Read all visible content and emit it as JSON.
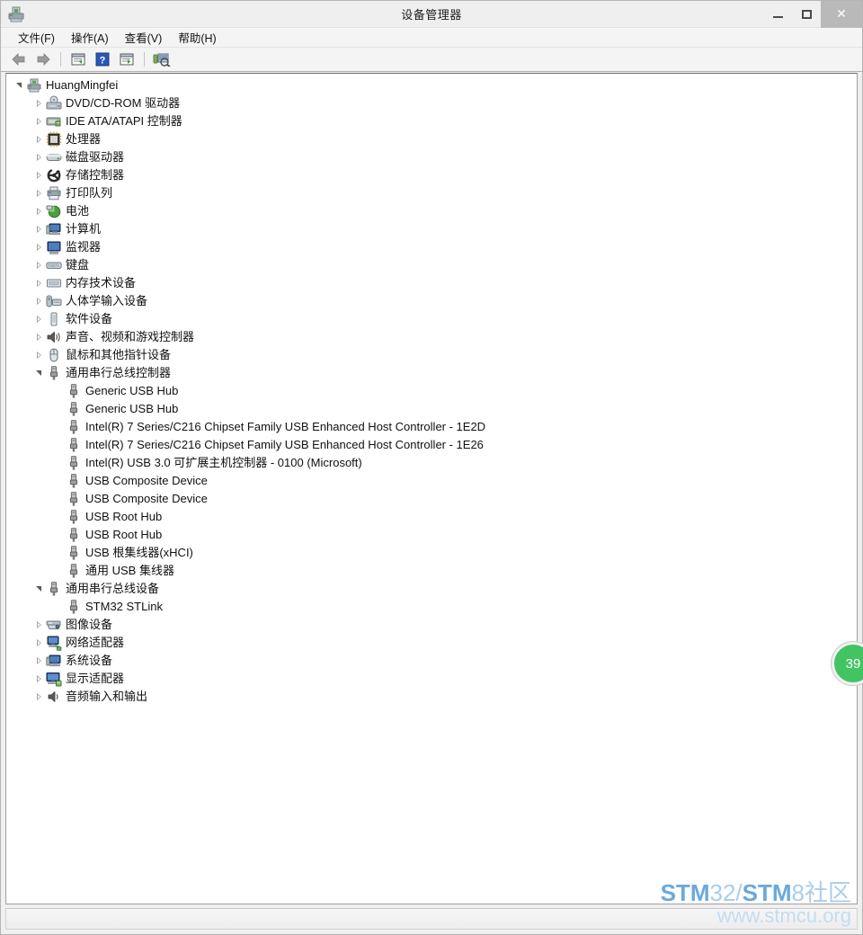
{
  "window": {
    "title": "设备管理器",
    "app_icon": "device-manager-icon",
    "buttons": {
      "minimize": "minimize-button",
      "maximize": "maximize-button",
      "close": "✕"
    }
  },
  "menubar": {
    "items": [
      {
        "label": "文件(F)",
        "name": "menu-file"
      },
      {
        "label": "操作(A)",
        "name": "menu-action"
      },
      {
        "label": "查看(V)",
        "name": "menu-view"
      },
      {
        "label": "帮助(H)",
        "name": "menu-help"
      }
    ]
  },
  "toolbar": {
    "items": [
      {
        "name": "back-arrow-icon",
        "title": "后退"
      },
      {
        "name": "forward-arrow-icon",
        "title": "前进"
      },
      {
        "name": "separator-1",
        "title": ""
      },
      {
        "name": "properties-icon",
        "title": "属性"
      },
      {
        "name": "help-icon",
        "title": "帮助"
      },
      {
        "name": "show-hidden-icon",
        "title": "显示"
      },
      {
        "name": "separator-2",
        "title": ""
      },
      {
        "name": "scan-hardware-changes-icon",
        "title": "扫描检测硬件改动"
      }
    ]
  },
  "tree": {
    "nodes": [
      {
        "label": "HuangMingfei",
        "level": 0,
        "state": "expanded",
        "icon": "computer-root-icon"
      },
      {
        "label": "DVD/CD-ROM 驱动器",
        "level": 1,
        "state": "collapsed",
        "icon": "dvd-drive-icon"
      },
      {
        "label": "IDE ATA/ATAPI 控制器",
        "level": 1,
        "state": "collapsed",
        "icon": "ide-controller-icon"
      },
      {
        "label": "处理器",
        "level": 1,
        "state": "collapsed",
        "icon": "processor-icon"
      },
      {
        "label": "磁盘驱动器",
        "level": 1,
        "state": "collapsed",
        "icon": "disk-drive-icon"
      },
      {
        "label": "存储控制器",
        "level": 1,
        "state": "collapsed",
        "icon": "storage-controller-icon"
      },
      {
        "label": "打印队列",
        "level": 1,
        "state": "collapsed",
        "icon": "print-queue-icon"
      },
      {
        "label": "电池",
        "level": 1,
        "state": "collapsed",
        "icon": "battery-icon"
      },
      {
        "label": "计算机",
        "level": 1,
        "state": "collapsed",
        "icon": "computer-icon"
      },
      {
        "label": "监视器",
        "level": 1,
        "state": "collapsed",
        "icon": "monitor-icon"
      },
      {
        "label": "键盘",
        "level": 1,
        "state": "collapsed",
        "icon": "keyboard-icon"
      },
      {
        "label": "内存技术设备",
        "level": 1,
        "state": "collapsed",
        "icon": "memory-device-icon"
      },
      {
        "label": "人体学输入设备",
        "level": 1,
        "state": "collapsed",
        "icon": "hid-icon"
      },
      {
        "label": "软件设备",
        "level": 1,
        "state": "collapsed",
        "icon": "software-device-icon"
      },
      {
        "label": "声音、视频和游戏控制器",
        "level": 1,
        "state": "collapsed",
        "icon": "sound-video-game-icon"
      },
      {
        "label": "鼠标和其他指针设备",
        "level": 1,
        "state": "collapsed",
        "icon": "mouse-icon"
      },
      {
        "label": "通用串行总线控制器",
        "level": 1,
        "state": "expanded",
        "icon": "usb-icon"
      },
      {
        "label": "Generic USB Hub",
        "level": 2,
        "state": "leaf",
        "icon": "usb-icon"
      },
      {
        "label": "Generic USB Hub",
        "level": 2,
        "state": "leaf",
        "icon": "usb-icon"
      },
      {
        "label": "Intel(R) 7 Series/C216 Chipset Family USB Enhanced Host Controller - 1E2D",
        "level": 2,
        "state": "leaf",
        "icon": "usb-icon"
      },
      {
        "label": "Intel(R) 7 Series/C216 Chipset Family USB Enhanced Host Controller - 1E26",
        "level": 2,
        "state": "leaf",
        "icon": "usb-icon"
      },
      {
        "label": "Intel(R) USB 3.0 可扩展主机控制器 - 0100 (Microsoft)",
        "level": 2,
        "state": "leaf",
        "icon": "usb-icon"
      },
      {
        "label": "USB Composite Device",
        "level": 2,
        "state": "leaf",
        "icon": "usb-icon"
      },
      {
        "label": "USB Composite Device",
        "level": 2,
        "state": "leaf",
        "icon": "usb-icon"
      },
      {
        "label": "USB Root Hub",
        "level": 2,
        "state": "leaf",
        "icon": "usb-icon"
      },
      {
        "label": "USB Root Hub",
        "level": 2,
        "state": "leaf",
        "icon": "usb-icon"
      },
      {
        "label": "USB 根集线器(xHCI)",
        "level": 2,
        "state": "leaf",
        "icon": "usb-icon"
      },
      {
        "label": "通用 USB 集线器",
        "level": 2,
        "state": "leaf",
        "icon": "usb-icon"
      },
      {
        "label": "通用串行总线设备",
        "level": 1,
        "state": "expanded",
        "icon": "usb-icon"
      },
      {
        "label": "STM32 STLink",
        "level": 2,
        "state": "leaf",
        "icon": "usb-icon"
      },
      {
        "label": "图像设备",
        "level": 1,
        "state": "collapsed",
        "icon": "imaging-device-icon"
      },
      {
        "label": "网络适配器",
        "level": 1,
        "state": "collapsed",
        "icon": "network-adapter-icon"
      },
      {
        "label": "系统设备",
        "level": 1,
        "state": "collapsed",
        "icon": "system-device-icon"
      },
      {
        "label": "显示适配器",
        "level": 1,
        "state": "collapsed",
        "icon": "display-adapter-icon"
      },
      {
        "label": "音频输入和输出",
        "level": 1,
        "state": "collapsed",
        "icon": "audio-io-icon"
      }
    ]
  },
  "statusbar": {
    "text": ""
  },
  "badge": {
    "value": "39",
    "color": "#43c463"
  },
  "watermark": {
    "line1_a": "STM",
    "line1_b": "32/",
    "line1_c": "STM",
    "line1_d": "8社区",
    "line2": "www.stmcu.org",
    "color_bold": "#6aa9dd",
    "color_light": "#aacdea"
  }
}
